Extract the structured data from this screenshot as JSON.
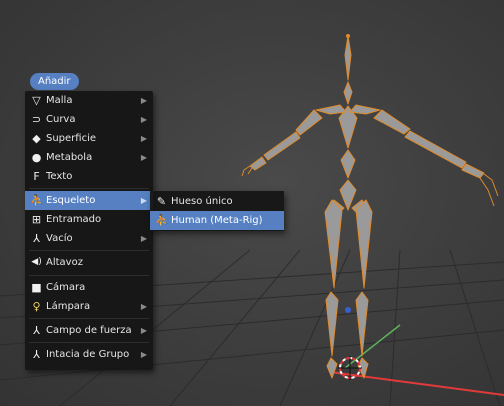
{
  "add_menu": {
    "title": "Añadir",
    "items": [
      {
        "label": "Malla",
        "icon": "mesh-icon",
        "submenu": true
      },
      {
        "label": "Curva",
        "icon": "curve-icon",
        "submenu": true
      },
      {
        "label": "Superficie",
        "icon": "surface-icon",
        "submenu": true
      },
      {
        "label": "Metabola",
        "icon": "metaball-icon",
        "submenu": true
      },
      {
        "label": "Texto",
        "icon": "text-icon",
        "submenu": false
      },
      {
        "label": "Esqueleto",
        "icon": "armature-icon",
        "submenu": true,
        "highlighted": true
      },
      {
        "label": "Entramado",
        "icon": "lattice-icon",
        "submenu": false
      },
      {
        "label": "Vacío",
        "icon": "empty-icon",
        "submenu": true
      },
      {
        "label": "Altavoz",
        "icon": "speaker-icon",
        "submenu": false
      },
      {
        "label": "Cámara",
        "icon": "camera-icon",
        "submenu": false
      },
      {
        "label": "Lámpara",
        "icon": "lamp-icon",
        "submenu": true
      },
      {
        "label": "Campo de fuerza",
        "icon": "force-field-icon",
        "submenu": true
      },
      {
        "label": "Intacia de Grupo",
        "icon": "group-instance-icon",
        "submenu": true
      }
    ]
  },
  "armature_submenu": {
    "items": [
      {
        "label": "Hueso único",
        "icon": "bone-icon",
        "highlighted": false
      },
      {
        "label": "Human (Meta-Rig)",
        "icon": "armature-icon",
        "highlighted": true
      }
    ]
  },
  "colors": {
    "accent": "#5680c2",
    "menu_bg": "#141414",
    "bone_fill": "#9a9a9a",
    "bone_outline": "#e08a2a"
  }
}
